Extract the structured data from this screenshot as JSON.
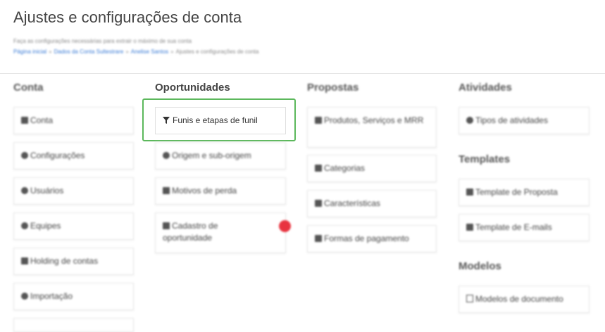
{
  "header": {
    "title": "Ajustes e configurações de conta",
    "subtitle": "Faça as configurações necessárias para extrair o máximo de sua conta",
    "breadcrumbs": [
      "Página inicial",
      "Dados da Conta Sultestrare",
      "Anelise Santos"
    ],
    "breadcrumb_current": "Ajustes e configurações de conta",
    "breadcrumb_sep": "»"
  },
  "conta": {
    "title": "Conta",
    "items": [
      {
        "label": "Conta",
        "icon": "home-icon"
      },
      {
        "label": "Configurações",
        "icon": "settings-icon"
      },
      {
        "label": "Usuários",
        "icon": "user-icon"
      },
      {
        "label": "Equipes",
        "icon": "team-icon"
      },
      {
        "label": "Holding de contas",
        "icon": "sitemap-icon"
      },
      {
        "label": "Importação",
        "icon": "cloud-upload-icon"
      }
    ]
  },
  "oportunidades": {
    "title": "Oportunidades",
    "items": [
      {
        "label": "Funis e etapas de funil",
        "icon": "filter-icon"
      },
      {
        "label": "Origem e sub-origem",
        "icon": "globe-icon"
      },
      {
        "label": "Motivos de perda",
        "icon": "trash-icon"
      },
      {
        "label": "Cadastro de oportunidade",
        "icon": "form-icon"
      }
    ]
  },
  "propostas": {
    "title": "Propostas",
    "items": [
      {
        "label": "Produtos, Serviços e MRR",
        "icon": "tag-icon"
      },
      {
        "label": "Categorias",
        "icon": "tag-icon"
      },
      {
        "label": "Características",
        "icon": "tag-icon"
      },
      {
        "label": "Formas de pagamento",
        "icon": "credit-card-icon"
      }
    ]
  },
  "atividades": {
    "title": "Atividades",
    "items": [
      {
        "label": "Tipos de atividades",
        "icon": "settings-icon"
      }
    ]
  },
  "templates": {
    "title": "Templates",
    "items": [
      {
        "label": "Template de Proposta",
        "icon": "document-icon"
      },
      {
        "label": "Template de E-mails",
        "icon": "envelope-icon"
      }
    ]
  },
  "modelos": {
    "title": "Modelos",
    "items": [
      {
        "label": "Modelos de documento",
        "icon": "file-icon"
      }
    ]
  },
  "colors": {
    "highlight": "#5cb85c",
    "notification_dot": "#e8333f",
    "link": "#3a7bd5"
  }
}
